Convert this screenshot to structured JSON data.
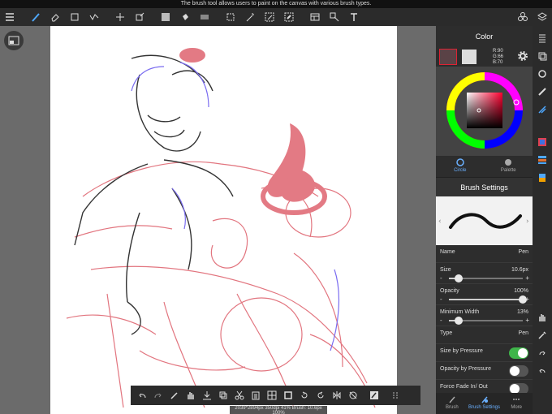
{
  "tooltip": "The brush tool allows users to paint on the canvas with various brush types.",
  "toolbar": {
    "tools": [
      "menu-icon",
      "brush-icon",
      "eraser-icon",
      "select-rect-icon",
      "dotted-line-icon",
      "move-icon",
      "transform-icon",
      "fill-color-icon",
      "bucket-icon",
      "gradient-icon",
      "lasso-icon",
      "magic-wand-icon",
      "select-pen-icon",
      "select-eraser-icon",
      "frame-icon",
      "object-icon",
      "text-icon",
      "materials-icon",
      "layers-icon"
    ]
  },
  "color_panel": {
    "title": "Color",
    "rgb": {
      "r": "R:90",
      "g": "G:66",
      "b": "B:70"
    },
    "tabs": [
      {
        "label": "Circle",
        "active": true
      },
      {
        "label": "Palette",
        "active": false
      }
    ],
    "main_color": "#5a4246"
  },
  "brush_settings": {
    "title": "Brush Settings",
    "name_label": "Name",
    "name_value": "Pen",
    "size_label": "Size",
    "size_value": "10.6px",
    "size_level": 0.13,
    "opacity_label": "Opacity",
    "opacity_value": "100%",
    "opacity_level": 1.0,
    "minwidth_label": "Minimum Width",
    "minwidth_value": "13%",
    "minwidth_level": 0.13,
    "type_label": "Type",
    "type_value": "Pen",
    "size_pressure_label": "Size by Pressure",
    "size_pressure_on": true,
    "opacity_pressure_label": "Opacity by Pressure",
    "opacity_pressure_on": false,
    "force_fade_label": "Force Fade In/ Out",
    "force_fade_on": false
  },
  "panel_tabs": [
    {
      "label": "Brush",
      "active": false
    },
    {
      "label": "Brush Settings",
      "active": true
    },
    {
      "label": "More",
      "active": false
    }
  ],
  "status": "2039*2894px 350dpi 41% Brush: 10.6px 100%"
}
